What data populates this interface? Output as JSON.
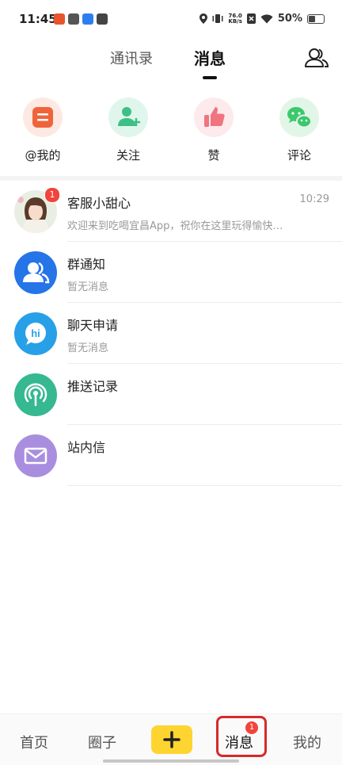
{
  "status_bar": {
    "time": "11:45",
    "net_speed_value": "76.0",
    "net_speed_unit": "KB/s",
    "battery": "50%"
  },
  "header": {
    "tabs": [
      {
        "label": "通讯录",
        "active": false
      },
      {
        "label": "消息",
        "active": true
      }
    ],
    "contacts_icon": "people-icon"
  },
  "categories": [
    {
      "label": "@我的",
      "icon": "message-square-icon",
      "color": "#f0643c",
      "bg": "#fde9e2"
    },
    {
      "label": "关注",
      "icon": "user-plus-icon",
      "color": "#3cc086",
      "bg": "#e0f6ec"
    },
    {
      "label": "赞",
      "icon": "thumbs-up-icon",
      "color": "#f07480",
      "bg": "#fdeaec"
    },
    {
      "label": "评论",
      "icon": "chat-bubbles-icon",
      "color": "#3cc86c",
      "bg": "#e2f6e8"
    }
  ],
  "messages": [
    {
      "title": "客服小甜心",
      "subtitle": "欢迎来到吃喝宜昌App，祝你在这里玩得愉快…",
      "time": "10:29",
      "badge": "1",
      "avatar": "customer-service-avatar"
    },
    {
      "title": "群通知",
      "subtitle": "暂无消息",
      "time": "",
      "badge": "",
      "avatar": "group-icon",
      "color": "#2574e8"
    },
    {
      "title": "聊天申请",
      "subtitle": "暂无消息",
      "time": "",
      "badge": "",
      "avatar": "hi-bubble-icon",
      "color": "#28a0e8"
    },
    {
      "title": "推送记录",
      "subtitle": "",
      "time": "",
      "badge": "",
      "avatar": "broadcast-icon",
      "color": "#36b890"
    },
    {
      "title": "站内信",
      "subtitle": "",
      "time": "",
      "badge": "",
      "avatar": "mail-icon",
      "color": "#a98ee0"
    }
  ],
  "bottom_nav": {
    "items": [
      {
        "label": "首页"
      },
      {
        "label": "圈子"
      },
      {
        "label": "消息",
        "badge": "1"
      },
      {
        "label": "我的"
      }
    ],
    "plus_color": "#fed430"
  }
}
